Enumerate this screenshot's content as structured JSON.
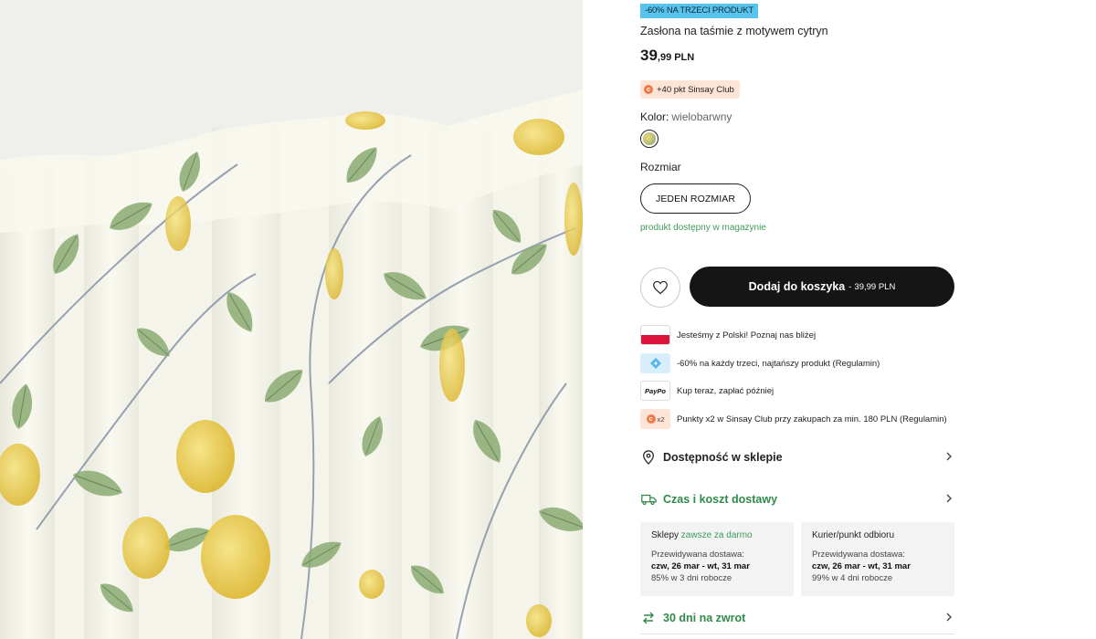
{
  "product": {
    "promo_badge": "-60% NA TRZECI PRODUKT",
    "title": "Zasłona na taśmie z motywem cytryn",
    "price_integer": "39",
    "price_decimal": ",99",
    "currency": "PLN",
    "points_badge": "+40 pkt Sinsay Club",
    "color_label": "Kolor:",
    "color_value": "wielobarwny",
    "size_label": "Rozmiar",
    "size_option": "JEDEN ROZMIAR",
    "stock_status": "produkt dostępny w magazynie"
  },
  "actions": {
    "add_to_cart_label": "Dodaj do koszyka",
    "add_to_cart_separator": "-",
    "add_to_cart_price": "39,99 PLN",
    "wishlist_icon": "heart-icon"
  },
  "benefits": [
    {
      "icon": "poland-flag-icon",
      "text": "Jesteśmy z Polski! Poznaj nas bliżej"
    },
    {
      "icon": "promo-tag-icon",
      "text": "-60% na każdy trzeci, najtańszy produkt (Regulamin)"
    },
    {
      "icon": "paypo-logo",
      "icon_text": "PayPo",
      "text": "Kup teraz, zapłać później"
    },
    {
      "icon": "points-x2-icon",
      "icon_text": "x2",
      "text": "Punkty x2 w Sinsay Club przy zakupach za min. 180 PLN (Regulamin)"
    }
  ],
  "accordions": {
    "store_availability": "Dostępność w sklepie",
    "delivery": "Czas i koszt dostawy",
    "returns": "30 dni na zwrot"
  },
  "delivery_options": [
    {
      "title": "Sklepy",
      "title_extra": "zawsze za darmo",
      "expected_label": "Przewidywana dostawa:",
      "dates": "czw, 26 mar - wt, 31 mar",
      "stat": "85% w 3 dni robocze"
    },
    {
      "title": "Kurier/punkt odbioru",
      "title_extra": "",
      "expected_label": "Przewidywana dostawa:",
      "dates": "czw, 26 mar - wt, 31 mar",
      "stat": "99% w 4 dni robocze"
    }
  ],
  "colors": {
    "cart_button_bg": "#151515",
    "promo_badge_bg": "#58c4ee",
    "points_badge_bg": "#fde4d6",
    "stock_green": "#3f9a5a"
  }
}
